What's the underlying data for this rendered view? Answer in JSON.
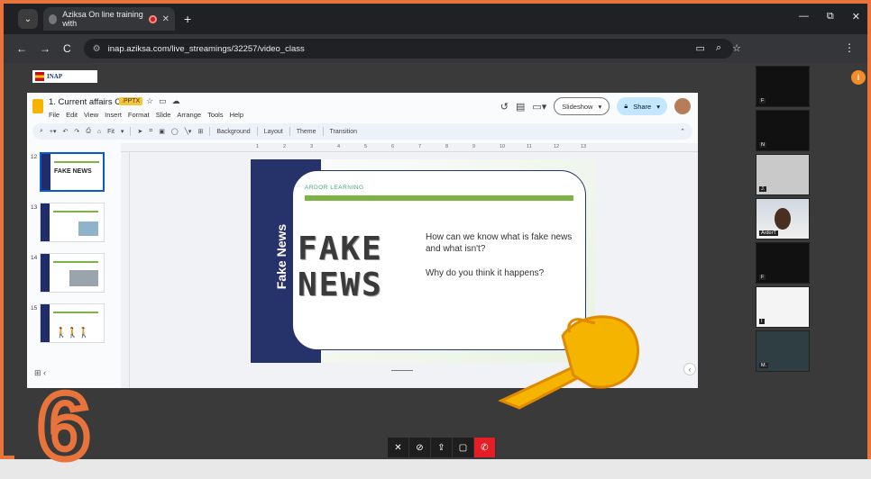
{
  "browser": {
    "tab_title": "Aziksa On line training with",
    "tab_close": "✕",
    "new_tab": "+",
    "url": "inap.aziksa.com/live_streamings/32257/video_class",
    "nav_back": "←",
    "nav_forward": "→",
    "nav_reload": "C",
    "window_min": "—",
    "window_restore": "⧉",
    "window_close": "✕"
  },
  "site": {
    "logo_text": "INAP",
    "info_badge": "i"
  },
  "slides_app": {
    "doc_title": "1. Current affairs C1",
    "file_badge": ".PPTX",
    "menus": [
      "File",
      "Edit",
      "View",
      "Insert",
      "Format",
      "Slide",
      "Arrange",
      "Tools",
      "Help"
    ],
    "slideshow_label": "Slideshow",
    "share_label": "Share",
    "toolbar": {
      "zoom": "Fit",
      "background": "Background",
      "layout": "Layout",
      "theme": "Theme",
      "transition": "Transition"
    },
    "ruler_ticks": [
      "1",
      "2",
      "3",
      "4",
      "5",
      "6",
      "7",
      "8",
      "9",
      "10",
      "11",
      "12",
      "13"
    ]
  },
  "filmstrip": [
    {
      "num": "12",
      "title": "FAKE NEWS",
      "selected": true
    },
    {
      "num": "13",
      "title": "",
      "selected": false
    },
    {
      "num": "14",
      "title": "",
      "selected": false
    },
    {
      "num": "15",
      "title": "",
      "selected": false
    }
  ],
  "slide": {
    "side_title": "Fake News",
    "brand": "ARDOR LEARNING",
    "big_word_1": "FAKE",
    "big_word_2": "NEWS",
    "question_1": "How can we know what is fake news and what isn't?",
    "question_2": "Why do you think it happens?"
  },
  "participants": [
    {
      "name": "F",
      "style": "dark"
    },
    {
      "name": "N",
      "style": "dark"
    },
    {
      "name": "J.",
      "style": "gray"
    },
    {
      "name": "ArdorT",
      "style": "cam"
    },
    {
      "name": "F",
      "style": "dark"
    },
    {
      "name": "I",
      "style": "white"
    },
    {
      "name": "M.",
      "style": "teal"
    }
  ],
  "overlay": {
    "step_number": "6",
    "accent_color": "#e8743b"
  }
}
